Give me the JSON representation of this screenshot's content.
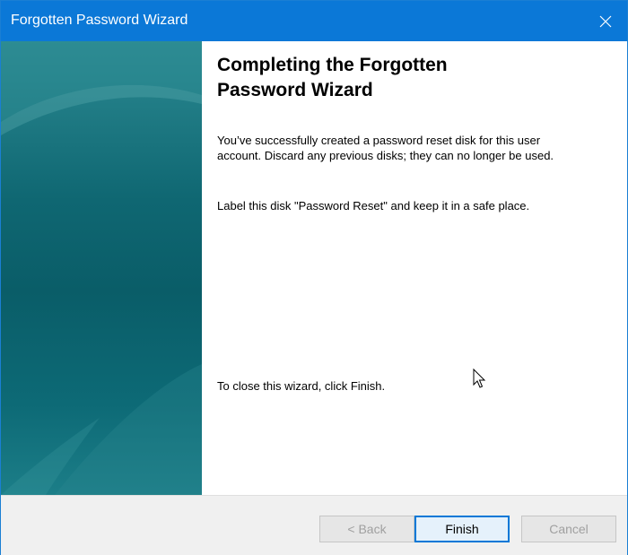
{
  "window": {
    "title": "Forgotten Password Wizard"
  },
  "content": {
    "heading": "Completing the Forgotten Password Wizard",
    "paragraph_success": "You’ve successfully created a password reset disk for this user account. Discard any previous disks; they can no longer be used.",
    "paragraph_label": "Label this disk \"Password Reset\" and keep it in a safe place.",
    "paragraph_close": "To close this wizard, click Finish."
  },
  "buttons": {
    "back_label": "< Back",
    "finish_label": "Finish",
    "cancel_label": "Cancel"
  },
  "colors": {
    "titlebar": "#0b78d7",
    "panel_dark": "#0a5d68",
    "panel_light": "#2c8a92",
    "footer": "#f0f0f0"
  },
  "icons": {
    "close": "close-icon",
    "cursor": "mouse-pointer-icon"
  }
}
